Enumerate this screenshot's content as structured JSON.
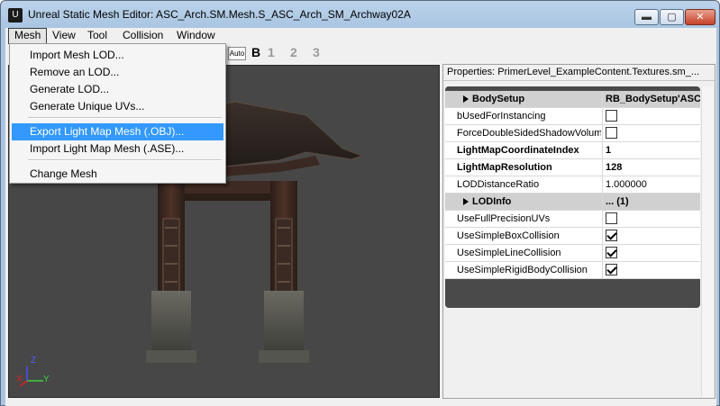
{
  "window": {
    "title": "Unreal Static Mesh Editor: ASC_Arch.SM.Mesh.S_ASC_Arch_SM_Archway02A",
    "min_glyph": "▬",
    "max_glyph": "▢",
    "close_glyph": "✕",
    "app_icon": "U"
  },
  "menubar": [
    "Mesh",
    "View",
    "Tool",
    "Collision",
    "Window"
  ],
  "toolbar": {
    "auto_label": "Auto",
    "b_label": "B",
    "lod_buttons": [
      "1",
      "2",
      "3"
    ]
  },
  "mesh_menu": {
    "items": [
      "Import Mesh LOD...",
      "Remove an LOD...",
      "Generate LOD...",
      "Generate Unique UVs...",
      "Export Light Map Mesh (.OBJ)...",
      "Import Light Map Mesh (.ASE)...",
      "Change Mesh"
    ],
    "highlighted_index": 4
  },
  "viewport": {
    "axis_labels": {
      "x": "X",
      "y": "Y",
      "z": "Z"
    }
  },
  "properties": {
    "header": "Properties: PrimerLevel_ExampleContent.Textures.sm_...",
    "rows": [
      {
        "name": "BodySetup",
        "value": "RB_BodySetup'ASC",
        "type": "group"
      },
      {
        "name": "bUsedForInstancing",
        "checked": false,
        "type": "check"
      },
      {
        "name": "ForceDoubleSidedShadowVolume",
        "checked": false,
        "type": "check"
      },
      {
        "name": "LightMapCoordinateIndex",
        "value": "1",
        "type": "bold"
      },
      {
        "name": "LightMapResolution",
        "value": "128",
        "type": "bold"
      },
      {
        "name": "LODDistanceRatio",
        "value": "1.000000",
        "type": "text"
      },
      {
        "name": "LODInfo",
        "value": "... (1)",
        "type": "group"
      },
      {
        "name": "UseFullPrecisionUVs",
        "checked": false,
        "type": "check"
      },
      {
        "name": "UseSimpleBoxCollision",
        "checked": true,
        "type": "check"
      },
      {
        "name": "UseSimpleLineCollision",
        "checked": true,
        "type": "check"
      },
      {
        "name": "UseSimpleRigidBodyCollision",
        "checked": true,
        "type": "check"
      }
    ]
  }
}
